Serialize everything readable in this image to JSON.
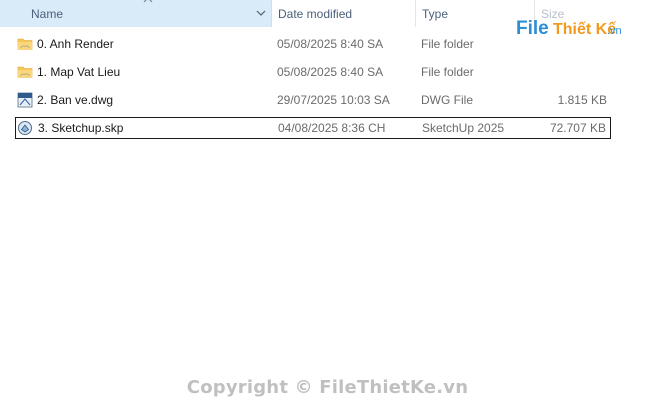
{
  "columns": {
    "name": "Name",
    "date": "Date modified",
    "type": "Type",
    "size": "Size"
  },
  "files": [
    {
      "name": "0. Anh Render",
      "date": "05/08/2025 8:40 SA",
      "type": "File folder",
      "size": "",
      "icon": "folder-icon"
    },
    {
      "name": "1. Map Vat Lieu",
      "date": "05/08/2025 8:40 SA",
      "type": "File folder",
      "size": "",
      "icon": "folder-icon"
    },
    {
      "name": "2. Ban ve.dwg",
      "date": "29/07/2025 10:03 SA",
      "type": "DWG File",
      "size": "1.815 KB",
      "icon": "dwg-file-icon"
    },
    {
      "name": "3. Sketchup.skp",
      "date": "04/08/2025 8:36 CH",
      "type": "SketchUp 2025",
      "size": "72.707 KB",
      "icon": "sketchup-file-icon",
      "selected": true
    }
  ],
  "logo": {
    "part1": "File",
    "part2": "Thiết Kế",
    "part3": ".vn"
  },
  "watermark": "Copyright © FileThietKe.vn",
  "colors": {
    "header_selected": "#d9ebf9",
    "folder": "#f6c657",
    "logo_blue": "#2a8fd6",
    "logo_orange": "#f39a1e"
  }
}
